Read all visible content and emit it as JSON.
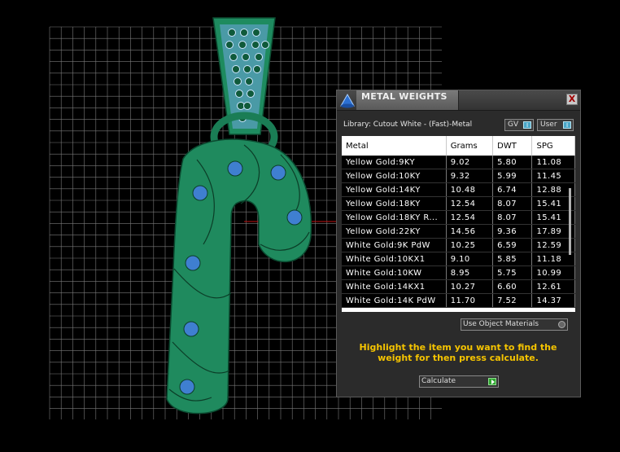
{
  "viewport": {
    "grid_color": "#7a7a7a",
    "model_color": "#1c8a5e",
    "stone_color": "#3f7fd0"
  },
  "panel": {
    "title": "METAL WEIGHTS",
    "close_label": "X",
    "library": "Library: Cutout White - (Fast)-Metal",
    "gv_label": "GV",
    "user_label": "User",
    "toggle_symbol": "I",
    "columns": [
      "Metal",
      "Grams",
      "DWT",
      "SPG"
    ],
    "rows": [
      [
        "Yellow Gold:9KY",
        "9.02",
        "5.80",
        "11.08"
      ],
      [
        "Yellow Gold:10KY",
        "9.32",
        "5.99",
        "11.45"
      ],
      [
        "Yellow Gold:14KY",
        "10.48",
        "6.74",
        "12.88"
      ],
      [
        "Yellow Gold:18KY",
        "12.54",
        "8.07",
        "15.41"
      ],
      [
        "Yellow Gold:18KY R...",
        "12.54",
        "8.07",
        "15.41"
      ],
      [
        "Yellow Gold:22KY",
        "14.56",
        "9.36",
        "17.89"
      ],
      [
        "White Gold:9K PdW",
        "10.25",
        "6.59",
        "12.59"
      ],
      [
        "White Gold:10KX1",
        "9.10",
        "5.85",
        "11.18"
      ],
      [
        "White Gold:10KW",
        "8.95",
        "5.75",
        "10.99"
      ],
      [
        "White Gold:14KX1",
        "10.27",
        "6.60",
        "12.61"
      ],
      [
        "White Gold:14K PdW",
        "11.70",
        "7.52",
        "14.37"
      ]
    ],
    "use_object_materials": "Use Object Materials",
    "instruction": "Highlight the item you want to find the weight for then press calculate.",
    "calculate_label": "Calculate",
    "instruction_color": "#f5c400"
  }
}
